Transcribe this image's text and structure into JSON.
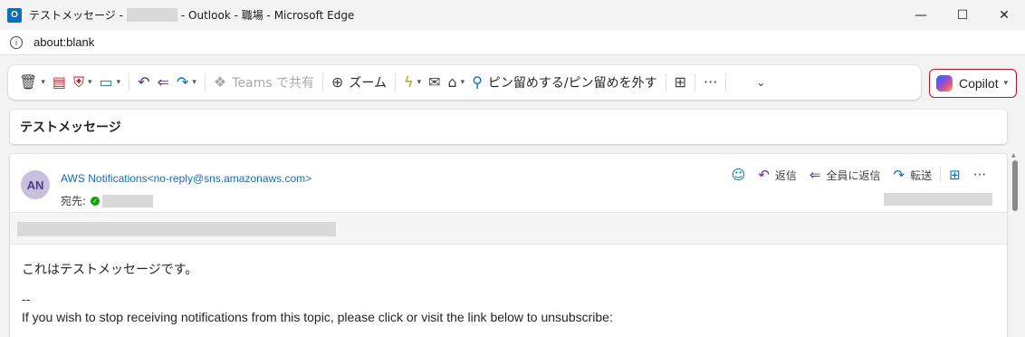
{
  "window": {
    "app_icon": "outlook-icon",
    "title_prefix": "テストメッセージ -",
    "title_suffix": "- Outlook - 職場 - Microsoft Edge",
    "minimize": "—",
    "maximize": "☐",
    "close": "✕"
  },
  "address_bar": {
    "url": "about:blank"
  },
  "ribbon": {
    "teams_share_label": "Teams で共有",
    "zoom_label": "ズーム",
    "pin_label": "ピン留めする/ピン留めを外す",
    "more_label": "···",
    "expand_chevron": "⌄",
    "copilot_label": "Copilot"
  },
  "message": {
    "subject": "テストメッセージ",
    "avatar_initials": "AN",
    "sender": "AWS Notifications<no-reply@sns.amazonaws.com>",
    "to_label": "宛先:",
    "actions": {
      "reply": "返信",
      "reply_all": "全員に返信",
      "forward": "転送",
      "more": "···"
    },
    "body": {
      "line1": "これはテストメッセージです。",
      "line2": "--",
      "line3": "If you wish to stop receiving notifications from this topic, please click or visit the link below to unsubscribe:"
    }
  },
  "colors": {
    "accent": "#0f6cbd",
    "copilot_border": "#c50f1f",
    "presence_available": "#13a10e",
    "avatar_bg": "#c8c0dd"
  }
}
